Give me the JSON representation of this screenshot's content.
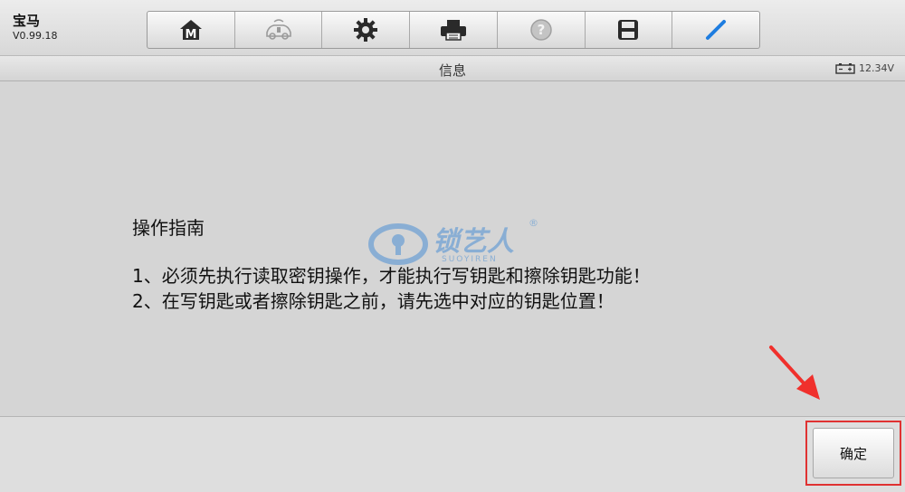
{
  "app": {
    "name": "宝马",
    "version": "V0.99.18"
  },
  "toolbar": {
    "items": [
      {
        "icon": "home-icon",
        "glyph": "M"
      },
      {
        "icon": "vehicle-icon"
      },
      {
        "icon": "settings-icon"
      },
      {
        "icon": "print-icon"
      },
      {
        "icon": "help-icon"
      },
      {
        "icon": "save-icon"
      },
      {
        "icon": "pen-icon"
      }
    ]
  },
  "header": {
    "title": "信息",
    "voltage": "12.34V"
  },
  "content": {
    "title": "操作指南",
    "lines": [
      "1、必须先执行读取密钥操作，才能执行写钥匙和擦除钥匙功能！",
      "2、在写钥匙或者擦除钥匙之前，请先选中对应的钥匙位置！"
    ]
  },
  "watermark": {
    "text": "锁艺人",
    "sub": "SUOYIREN",
    "mark": "®"
  },
  "footer": {
    "confirm_label": "确定"
  },
  "colors": {
    "highlight": "#e03232",
    "watermark": "#4c8fd4"
  }
}
